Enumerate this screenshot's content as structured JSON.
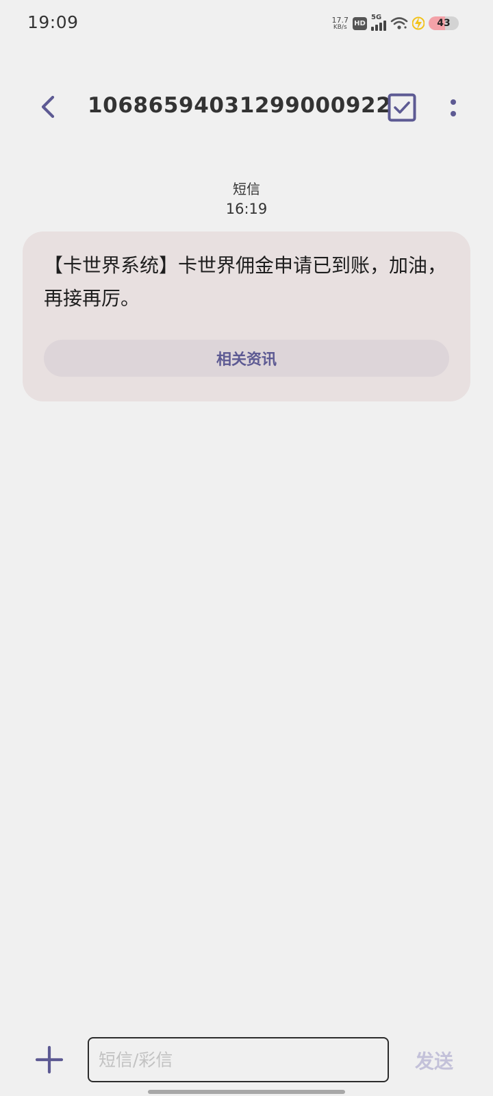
{
  "status_bar": {
    "time": "19:09",
    "net_speed_value": "17.7",
    "net_speed_unit": "KB/s",
    "hd_label": "HD",
    "network_label": "5G",
    "battery_level": "43"
  },
  "header": {
    "title": "10686594031299000922"
  },
  "conversation": {
    "type_label": "短信",
    "time": "16:19",
    "message_text": "【卡世界系统】卡世界佣金申请已到账，加油，再接再厉。",
    "info_button_label": "相关资讯"
  },
  "composer": {
    "input_value": "",
    "input_placeholder": "短信/彩信",
    "send_label": "发送"
  },
  "colors": {
    "accent": "#5d5a93",
    "bubble_bg": "#e8e0e0",
    "page_bg": "#f0f0f0"
  }
}
